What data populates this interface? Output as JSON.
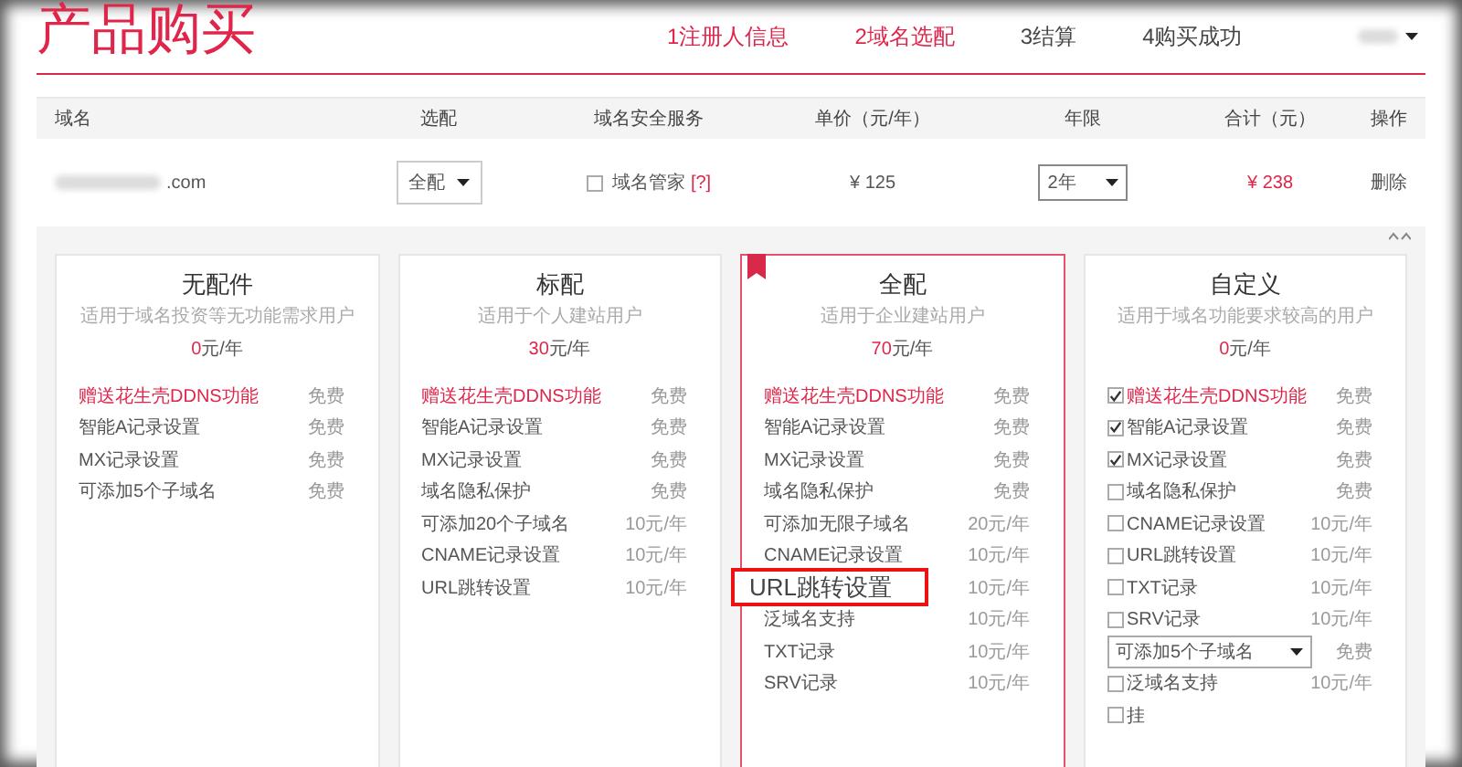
{
  "header": {
    "title": "产品购买",
    "steps": [
      {
        "label": "1注册人信息",
        "selected": true
      },
      {
        "label": "2域名选配",
        "selected": true
      },
      {
        "label": "3结算",
        "selected": false
      },
      {
        "label": "4购买成功",
        "selected": false
      }
    ]
  },
  "table": {
    "columns": [
      "域名",
      "选配",
      "域名安全服务",
      "单价（元/年）",
      "年限",
      "合计（元）",
      "操作"
    ],
    "rows": [
      {
        "domain_suffix": ".com",
        "package": "全配",
        "security": {
          "label": "域名管家",
          "help": "[?]",
          "checked": false
        },
        "unit_price": "¥ 125",
        "years": "2年",
        "total": "¥ 238",
        "action": "删除"
      }
    ]
  },
  "plans": [
    {
      "title": "无配件",
      "subtitle": "适用于域名投资等无功能需求用户",
      "price_amount": "0",
      "price_unit": "元/年",
      "recommended": false,
      "selected": false,
      "features": [
        {
          "kind": "plain",
          "name": "赠送花生壳DDNS功能",
          "price": "免费",
          "highlight": true
        },
        {
          "kind": "plain",
          "name": "智能A记录设置",
          "price": "免费",
          "highlight": false
        },
        {
          "kind": "plain",
          "name": "MX记录设置",
          "price": "免费",
          "highlight": false
        },
        {
          "kind": "plain",
          "name": "可添加5个子域名",
          "price": "免费",
          "highlight": false
        }
      ]
    },
    {
      "title": "标配",
      "subtitle": "适用于个人建站用户",
      "price_amount": "30",
      "price_unit": "元/年",
      "recommended": false,
      "selected": false,
      "features": [
        {
          "kind": "plain",
          "name": "赠送花生壳DDNS功能",
          "price": "免费",
          "highlight": true
        },
        {
          "kind": "plain",
          "name": "智能A记录设置",
          "price": "免费",
          "highlight": false
        },
        {
          "kind": "plain",
          "name": "MX记录设置",
          "price": "免费",
          "highlight": false
        },
        {
          "kind": "plain",
          "name": "域名隐私保护",
          "price": "免费",
          "highlight": false
        },
        {
          "kind": "plain",
          "name": "可添加20个子域名",
          "price": "10元/年",
          "highlight": false
        },
        {
          "kind": "plain",
          "name": "CNAME记录设置",
          "price": "10元/年",
          "highlight": false
        },
        {
          "kind": "plain",
          "name": "URL跳转设置",
          "price": "10元/年",
          "highlight": false
        }
      ]
    },
    {
      "title": "全配",
      "subtitle": "适用于企业建站用户",
      "price_amount": "70",
      "price_unit": "元/年",
      "recommended": true,
      "selected": true,
      "callout": "URL跳转设置",
      "features": [
        {
          "kind": "plain",
          "name": "赠送花生壳DDNS功能",
          "price": "免费",
          "highlight": true
        },
        {
          "kind": "plain",
          "name": "智能A记录设置",
          "price": "免费",
          "highlight": false
        },
        {
          "kind": "plain",
          "name": "MX记录设置",
          "price": "免费",
          "highlight": false
        },
        {
          "kind": "plain",
          "name": "域名隐私保护",
          "price": "免费",
          "highlight": false
        },
        {
          "kind": "plain",
          "name": "可添加无限子域名",
          "price": "20元/年",
          "highlight": false
        },
        {
          "kind": "plain",
          "name": "CNAME记录设置",
          "price": "10元/年",
          "highlight": false
        },
        {
          "kind": "plain",
          "price": "10元/年"
        },
        {
          "kind": "plain",
          "name": "泛域名支持",
          "price": "10元/年",
          "highlight": false
        },
        {
          "kind": "plain",
          "name": "TXT记录",
          "price": "10元/年",
          "highlight": false
        },
        {
          "kind": "plain",
          "name": "SRV记录",
          "price": "10元/年",
          "highlight": false
        }
      ]
    },
    {
      "title": "自定义",
      "subtitle": "适用于域名功能要求较高的用户",
      "price_amount": "0",
      "price_unit": "元/年",
      "recommended": false,
      "selected": false,
      "features": [
        {
          "kind": "checkbox",
          "name": "赠送花生壳DDNS功能",
          "price": "免费",
          "highlight": true,
          "checked": true
        },
        {
          "kind": "checkbox",
          "name": "智能A记录设置",
          "price": "免费",
          "highlight": false,
          "checked": true
        },
        {
          "kind": "checkbox",
          "name": "MX记录设置",
          "price": "免费",
          "highlight": false,
          "checked": true
        },
        {
          "kind": "checkbox",
          "name": "域名隐私保护",
          "price": "免费",
          "highlight": false,
          "checked": false
        },
        {
          "kind": "checkbox",
          "name": "CNAME记录设置",
          "price": "10元/年",
          "highlight": false,
          "checked": false
        },
        {
          "kind": "checkbox",
          "name": "URL跳转设置",
          "price": "10元/年",
          "highlight": false,
          "checked": false
        },
        {
          "kind": "checkbox",
          "name": "TXT记录",
          "price": "10元/年",
          "highlight": false,
          "checked": false
        },
        {
          "kind": "checkbox",
          "name": "SRV记录",
          "price": "10元/年",
          "highlight": false,
          "checked": false
        },
        {
          "kind": "select",
          "name": "可添加5个子域名",
          "price": "免费",
          "highlight": false
        },
        {
          "kind": "checkbox",
          "name": "泛域名支持",
          "price": "10元/年",
          "highlight": false,
          "checked": false
        },
        {
          "kind": "checkbox",
          "name": "挂",
          "highlight": false,
          "checked": false
        }
      ]
    }
  ]
}
